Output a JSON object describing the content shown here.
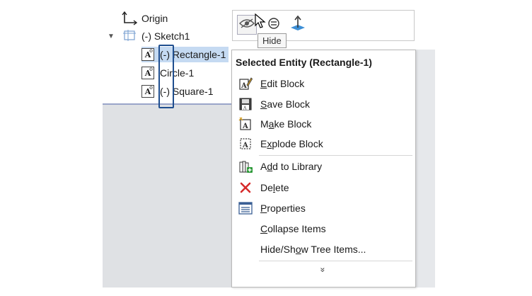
{
  "tree": {
    "origin_label": "Origin",
    "sketch_label": "(-) Sketch1",
    "items": [
      {
        "prefix": "(-)",
        "name": "Rectangle-1",
        "selected": true
      },
      {
        "prefix": "",
        "name": "Circle-1",
        "selected": false
      },
      {
        "prefix": "(-)",
        "name": "Square-1",
        "selected": false
      }
    ]
  },
  "toolbar": {
    "tooltip": "Hide",
    "buttons": [
      "hide-eye-icon",
      "swap-icon",
      "normal-to-icon"
    ]
  },
  "context_menu": {
    "header": "Selected Entity (Rectangle-1)",
    "items": [
      {
        "label": "Edit Block",
        "icon": "edit-block-icon",
        "underline": "E"
      },
      {
        "label": "Save Block",
        "icon": "save-block-icon",
        "underline": "S"
      },
      {
        "label": "Make Block",
        "icon": "make-block-icon",
        "underline": "a"
      },
      {
        "label": "Explode Block",
        "icon": "explode-block-icon",
        "underline": "x"
      },
      {
        "label": "Add to Library",
        "icon": "add-library-icon",
        "underline": "d"
      },
      {
        "label": "Delete",
        "icon": "delete-icon",
        "underline": "l"
      },
      {
        "label": "Properties",
        "icon": "properties-icon",
        "underline": "P"
      },
      {
        "label": "Collapse Items",
        "icon": "",
        "underline": "C"
      },
      {
        "label": "Hide/Show Tree Items...",
        "icon": "",
        "underline": "o"
      }
    ],
    "expand_glyph": "»"
  },
  "colors": {
    "selection": "#c5daf2",
    "highlight_box": "#1f4e8f",
    "delete_red": "#d62b2b"
  }
}
